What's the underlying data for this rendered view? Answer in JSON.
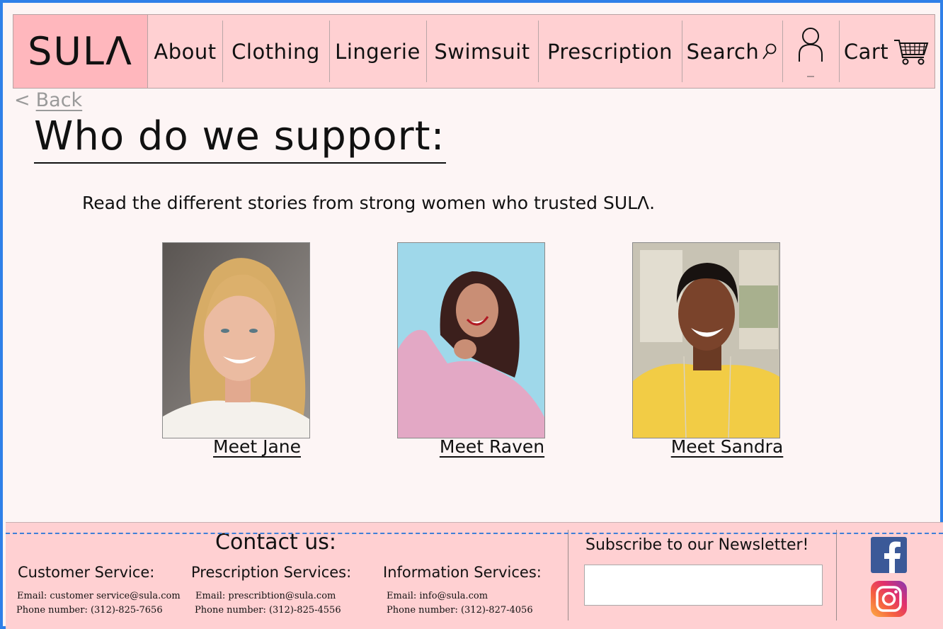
{
  "nav": {
    "logo": "SULΛ",
    "items": [
      "About",
      "Clothing",
      "Lingerie",
      "Swimsuit",
      "Prescription"
    ],
    "search_label": "Search",
    "cart_label": "Cart",
    "search_icon": "search-icon",
    "account_icon": "user-icon",
    "cart_icon": "cart-icon"
  },
  "back": {
    "arrow": "<",
    "label": "Back"
  },
  "page_title": "Who do we support:",
  "intro": "Read the different stories from strong women who trusted SULΛ.",
  "stories": [
    {
      "link": "Meet Jane"
    },
    {
      "link": "Meet Raven"
    },
    {
      "link": "Meet Sandra"
    }
  ],
  "footer": {
    "contact_title": "Contact us:",
    "services": [
      {
        "title": "Customer Service:",
        "email": "Email: customer service@sula.com",
        "phone": "Phone number: (312)-825-7656"
      },
      {
        "title": "Prescription Services:",
        "email": "Email: prescribtion@sula.com",
        "phone": "Phone number: (312)-825-4556"
      },
      {
        "title": "Information Services:",
        "email": "Email: info@sula.com",
        "phone": "Phone number: (312)-827-4056"
      }
    ],
    "newsletter_title": "Subscribe to our Newsletter!",
    "newsletter_value": "",
    "social_icons": [
      "facebook-icon",
      "instagram-icon"
    ]
  },
  "colors": {
    "frame": "#2f80e8",
    "nav_bg": "#ffd0d2",
    "logo_bg": "#ffb7bd",
    "page_bg": "#fdf5f5",
    "footer_bg": "#ffd0d2",
    "facebook": "#3b5998"
  }
}
